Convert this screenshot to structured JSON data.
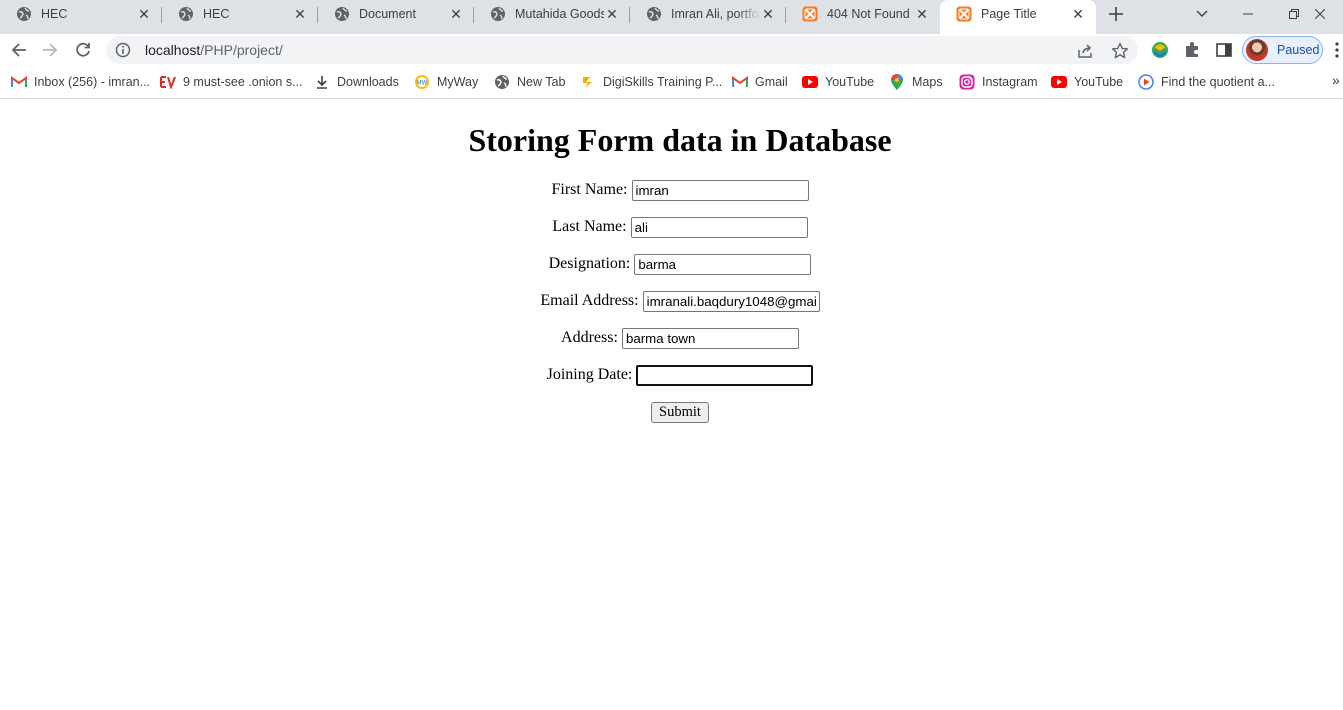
{
  "tabs": [
    {
      "title": "HEC",
      "icon": "globe-icon"
    },
    {
      "title": "HEC",
      "icon": "globe-icon"
    },
    {
      "title": "Document",
      "icon": "globe-icon"
    },
    {
      "title": "Mutahida Goods",
      "icon": "globe-icon"
    },
    {
      "title": "Imran Ali, portfolio",
      "icon": "globe-icon"
    },
    {
      "title": "404 Not Found",
      "icon": "xampp-icon"
    },
    {
      "title": "Page Title",
      "icon": "xampp-icon"
    }
  ],
  "toolbar": {
    "url_host": "localhost",
    "url_path": "/PHP/project/",
    "profile_label": "Paused"
  },
  "bookmarks": [
    {
      "label": "Inbox (256) - imran...",
      "icon": "gmail-icon"
    },
    {
      "label": "9 must-see .onion s...",
      "icon": "ev-icon"
    },
    {
      "label": "Downloads",
      "icon": "download-icon"
    },
    {
      "label": "MyWay",
      "icon": "myway-icon"
    },
    {
      "label": "New Tab",
      "icon": "globe-icon"
    },
    {
      "label": "DigiSkills Training P...",
      "icon": "digiskills-icon"
    },
    {
      "label": "Gmail",
      "icon": "gmail-icon"
    },
    {
      "label": "YouTube",
      "icon": "youtube-icon"
    },
    {
      "label": "Maps",
      "icon": "maps-icon"
    },
    {
      "label": "Instagram",
      "icon": "instagram-icon"
    },
    {
      "label": "YouTube",
      "icon": "youtube-icon"
    },
    {
      "label": "Find the quotient a...",
      "icon": "play-icon"
    }
  ],
  "page": {
    "heading": "Storing Form data in Database",
    "fields": [
      {
        "label": "First Name:",
        "value": "imran"
      },
      {
        "label": "Last Name:",
        "value": "ali"
      },
      {
        "label": "Designation:",
        "value": "barma"
      },
      {
        "label": "Email Address:",
        "value": "imranali.baqdury1048@gmai"
      },
      {
        "label": "Address:",
        "value": "barma town"
      },
      {
        "label": "Joining Date:",
        "value": ""
      }
    ],
    "submit_label": "Submit"
  },
  "colors": {
    "tabstrip_bg": "#dee1e6",
    "omnibox_bg": "#f1f3f4",
    "profile_accent": "#1a73e8"
  }
}
